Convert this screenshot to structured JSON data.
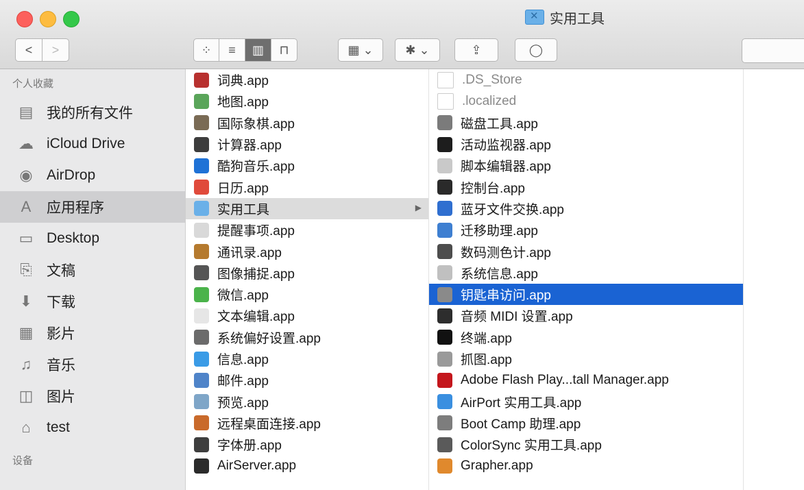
{
  "window": {
    "title": "实用工具"
  },
  "toolbar": {
    "back": "<",
    "forward": ">",
    "views": [
      "grid-view",
      "list-view",
      "column-view",
      "coverflow-view"
    ],
    "arrange_icon": "arrange-icon",
    "action_icon": "gear-icon",
    "share_icon": "share-icon",
    "tag_icon": "tag-icon"
  },
  "sidebar": {
    "favorites_header": "个人收藏",
    "items": [
      {
        "label": "我的所有文件",
        "icon": "▤"
      },
      {
        "label": "iCloud Drive",
        "icon": "☁"
      },
      {
        "label": "AirDrop",
        "icon": "◉"
      },
      {
        "label": "应用程序",
        "icon": "A"
      },
      {
        "label": "Desktop",
        "icon": "▭"
      },
      {
        "label": "文稿",
        "icon": "⎘"
      },
      {
        "label": "下载",
        "icon": "⬇"
      },
      {
        "label": "影片",
        "icon": "▦"
      },
      {
        "label": "音乐",
        "icon": "♫"
      },
      {
        "label": "图片",
        "icon": "◫"
      },
      {
        "label": "test",
        "icon": "⌂"
      }
    ],
    "devices_header": "设备",
    "selected_index": 3
  },
  "column1": [
    {
      "label": "词典.app",
      "color": "#b8312f"
    },
    {
      "label": "地图.app",
      "color": "#5aa55a"
    },
    {
      "label": "国际象棋.app",
      "color": "#7a6b55"
    },
    {
      "label": "计算器.app",
      "color": "#3d3d3d"
    },
    {
      "label": "酷狗音乐.app",
      "color": "#1f72d6"
    },
    {
      "label": "日历.app",
      "color": "#e04a3b"
    },
    {
      "label": "实用工具",
      "color": "#6ab0e8",
      "selected": true,
      "has_children": true
    },
    {
      "label": "提醒事项.app",
      "color": "#d9d9d9"
    },
    {
      "label": "通讯录.app",
      "color": "#b57a2e"
    },
    {
      "label": "图像捕捉.app",
      "color": "#555555"
    },
    {
      "label": "微信.app",
      "color": "#4bb34b"
    },
    {
      "label": "文本编辑.app",
      "color": "#e6e6e6"
    },
    {
      "label": "系统偏好设置.app",
      "color": "#6b6b6b"
    },
    {
      "label": "信息.app",
      "color": "#3a9be6"
    },
    {
      "label": "邮件.app",
      "color": "#4f84c9"
    },
    {
      "label": "预览.app",
      "color": "#7fa6c8"
    },
    {
      "label": "远程桌面连接.app",
      "color": "#c96a2b"
    },
    {
      "label": "字体册.app",
      "color": "#3e3e3e"
    },
    {
      "label": "AirServer.app",
      "color": "#2b2b2b"
    }
  ],
  "column2": [
    {
      "label": ".DS_Store",
      "kind": "doc",
      "dim": true
    },
    {
      "label": ".localized",
      "kind": "doc",
      "dim": true
    },
    {
      "label": "磁盘工具.app",
      "color": "#7b7b7b"
    },
    {
      "label": "活动监视器.app",
      "color": "#1d1d1d"
    },
    {
      "label": "脚本编辑器.app",
      "color": "#c9c9c9"
    },
    {
      "label": "控制台.app",
      "color": "#2a2a2a"
    },
    {
      "label": "蓝牙文件交换.app",
      "color": "#2f6fd0"
    },
    {
      "label": "迁移助理.app",
      "color": "#3e7fd1"
    },
    {
      "label": "数码测色计.app",
      "color": "#4d4d4d"
    },
    {
      "label": "系统信息.app",
      "color": "#c0c0c0"
    },
    {
      "label": "钥匙串访问.app",
      "color": "#8a8a8a",
      "selected": true
    },
    {
      "label": "音频 MIDI 设置.app",
      "color": "#2d2d2d"
    },
    {
      "label": "终端.app",
      "color": "#111111"
    },
    {
      "label": "抓图.app",
      "color": "#9a9a9a"
    },
    {
      "label": "Adobe Flash Play...tall Manager.app",
      "color": "#c4161c"
    },
    {
      "label": "AirPort 实用工具.app",
      "color": "#3a8fe0"
    },
    {
      "label": "Boot Camp 助理.app",
      "color": "#7d7d7d"
    },
    {
      "label": "ColorSync 实用工具.app",
      "color": "#5a5a5a"
    },
    {
      "label": "Grapher.app",
      "color": "#e0892d"
    }
  ]
}
